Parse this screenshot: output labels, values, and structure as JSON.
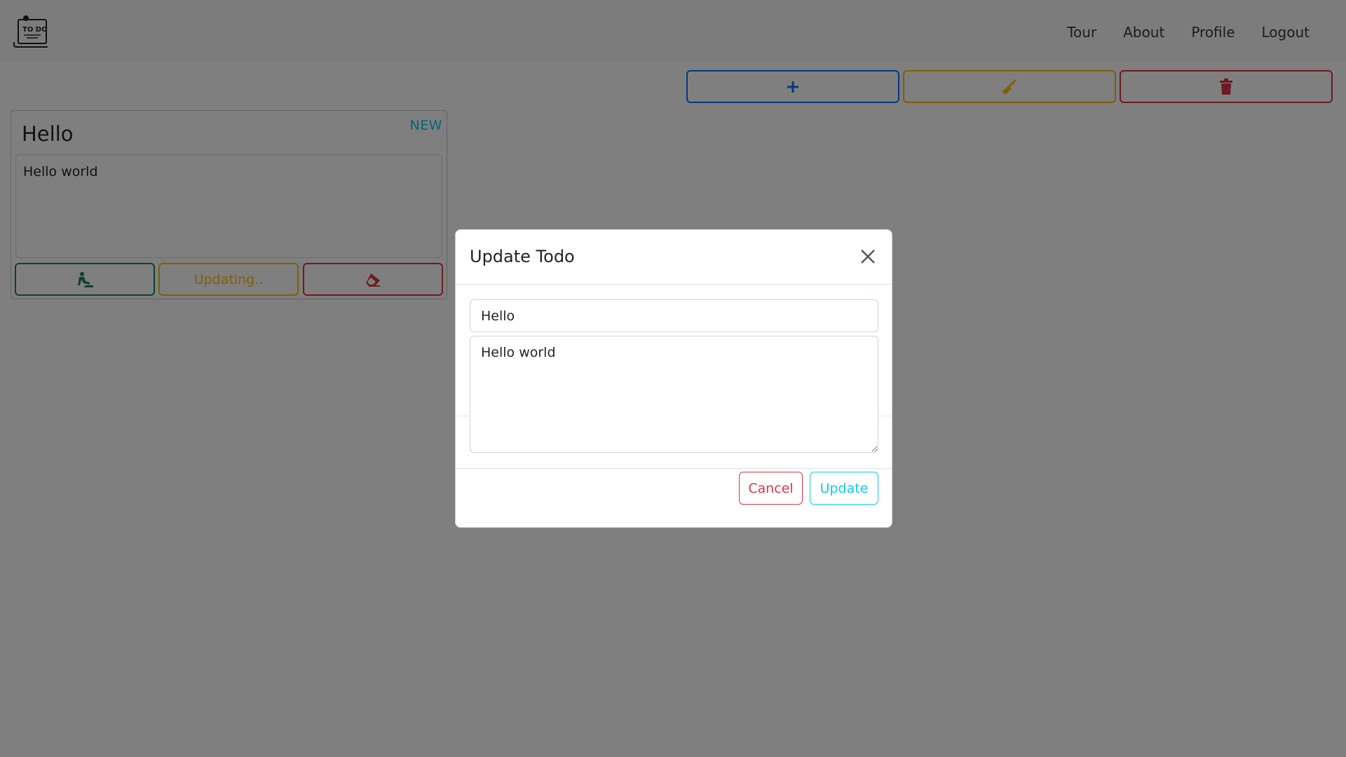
{
  "nav": {
    "logo_text": "TO DO",
    "links": [
      "Tour",
      "About",
      "Profile",
      "Logout"
    ]
  },
  "actions": {
    "add_icon": "plus-icon",
    "clean_icon": "broom-icon",
    "trash_icon": "trash-icon"
  },
  "todo": {
    "title": "Hello",
    "badge": "NEW",
    "description": "Hello world",
    "progress_icon": "digging-person-icon",
    "update_label": "Updating..",
    "erase_icon": "eraser-icon"
  },
  "modal": {
    "title": "Update Todo",
    "title_value": "Hello",
    "description_value": "Hello world",
    "cancel_label": "Cancel",
    "update_label": "Update"
  },
  "colors": {
    "primary": "#0d6efd",
    "warning": "#ffc107",
    "danger": "#dc3545",
    "success": "#198754",
    "info": "#0dcaf0"
  }
}
